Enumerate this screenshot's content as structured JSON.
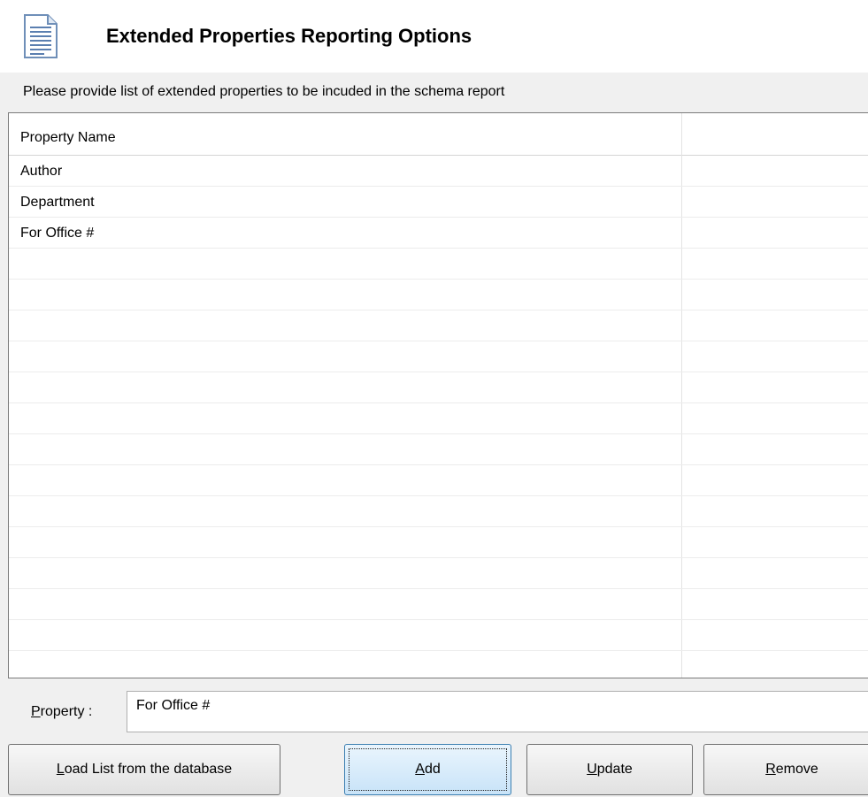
{
  "header": {
    "title": "Extended Properties Reporting Options",
    "icon": "document-icon"
  },
  "instructions": "Please provide list of extended properties to be incuded in the schema report",
  "grid": {
    "columns": [
      "Property Name",
      ""
    ],
    "rows": [
      "Author",
      "Department",
      "For Office #",
      "",
      "",
      "",
      "",
      "",
      "",
      "",
      "",
      "",
      "",
      "",
      "",
      "",
      "",
      ""
    ]
  },
  "property": {
    "label_accel": "P",
    "label_rest": "roperty :",
    "value": "For Office #"
  },
  "buttons": {
    "load": {
      "accel": "L",
      "rest": "oad List from the database"
    },
    "add": {
      "accel": "A",
      "rest": "dd"
    },
    "update": {
      "accel": "U",
      "rest": "pdate"
    },
    "remove": {
      "accel": "R",
      "rest": "emove"
    }
  }
}
